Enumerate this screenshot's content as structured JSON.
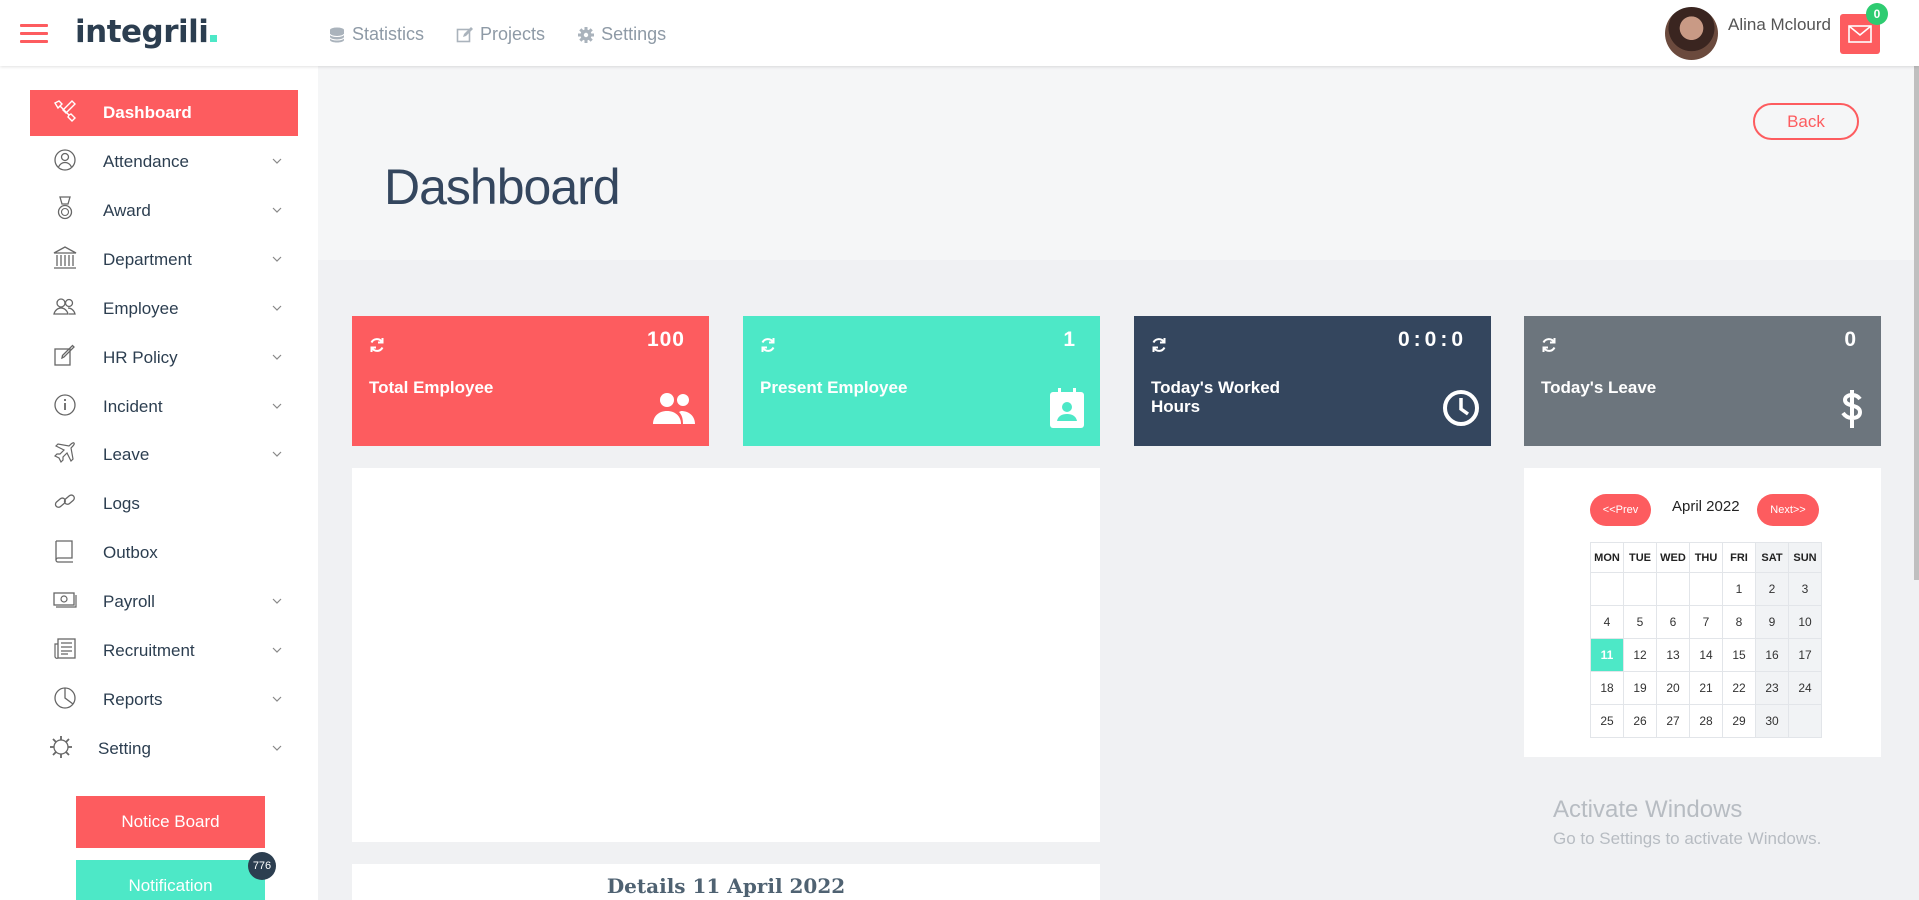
{
  "app": {
    "logo_text": "integrili",
    "accent": "#fd5c5f",
    "teal": "#4de8c7",
    "dark": "#34465e",
    "gray": "#6c757d"
  },
  "topnav": [
    {
      "label": "Statistics",
      "icon": "database-icon"
    },
    {
      "label": "Projects",
      "icon": "edit-icon"
    },
    {
      "label": "Settings",
      "icon": "gear-icon"
    }
  ],
  "user": {
    "name": "Alina Mclourd",
    "mail_count": "0"
  },
  "sidebar": {
    "items": [
      {
        "label": "Dashboard",
        "icon": "tools-icon",
        "active": true,
        "has_submenu": false
      },
      {
        "label": "Attendance",
        "icon": "user-circle-icon",
        "has_submenu": true
      },
      {
        "label": "Award",
        "icon": "medal-icon",
        "has_submenu": true
      },
      {
        "label": "Department",
        "icon": "bank-icon",
        "has_submenu": true
      },
      {
        "label": "Employee",
        "icon": "users-icon",
        "has_submenu": true
      },
      {
        "label": "HR Policy",
        "icon": "edit-note-icon",
        "has_submenu": true
      },
      {
        "label": "Incident",
        "icon": "info-icon",
        "has_submenu": true
      },
      {
        "label": "Leave",
        "icon": "plane-icon",
        "has_submenu": true
      },
      {
        "label": "Logs",
        "icon": "link-icon",
        "has_submenu": false
      },
      {
        "label": "Outbox",
        "icon": "book-icon",
        "has_submenu": false
      },
      {
        "label": "Payroll",
        "icon": "money-icon",
        "has_submenu": true
      },
      {
        "label": "Recruitment",
        "icon": "newspaper-icon",
        "has_submenu": true
      },
      {
        "label": "Reports",
        "icon": "pie-chart-icon",
        "has_submenu": true
      },
      {
        "label": "Setting",
        "icon": "gear-icon",
        "has_submenu": true
      }
    ],
    "notice_board": "Notice Board",
    "notification": "Notification",
    "notification_count": "776"
  },
  "header": {
    "title": "Dashboard",
    "back_label": "Back"
  },
  "cards": [
    {
      "label": "Total Employee",
      "value": "100",
      "color": "#fd5c5f",
      "icon": "users-icon"
    },
    {
      "label": "Present Employee",
      "value": "1",
      "color": "#4de8c7",
      "icon": "contact-badge-icon"
    },
    {
      "label": "Today's Worked Hours",
      "value": "0:0:0",
      "color": "#34465e",
      "icon": "clock-icon"
    },
    {
      "label": "Today's Leave",
      "value": "0",
      "color": "#6c757d",
      "icon": "dollar-icon"
    }
  ],
  "calendar": {
    "prev": "<<Prev",
    "next": "Next>>",
    "month": "April 2022",
    "days": [
      "MON",
      "TUE",
      "WED",
      "THU",
      "FRI",
      "SAT",
      "SUN"
    ],
    "weeks": [
      [
        "",
        "",
        "",
        "",
        "1",
        "2",
        "3"
      ],
      [
        "4",
        "5",
        "6",
        "7",
        "8",
        "9",
        "10"
      ],
      [
        "11",
        "12",
        "13",
        "14",
        "15",
        "16",
        "17"
      ],
      [
        "18",
        "19",
        "20",
        "21",
        "22",
        "23",
        "24"
      ],
      [
        "25",
        "26",
        "27",
        "28",
        "29",
        "30",
        ""
      ]
    ],
    "today": "11"
  },
  "details": {
    "title": "Details 11 April 2022"
  },
  "watermark": {
    "line1": "Activate Windows",
    "line2": "Go to Settings to activate Windows."
  }
}
